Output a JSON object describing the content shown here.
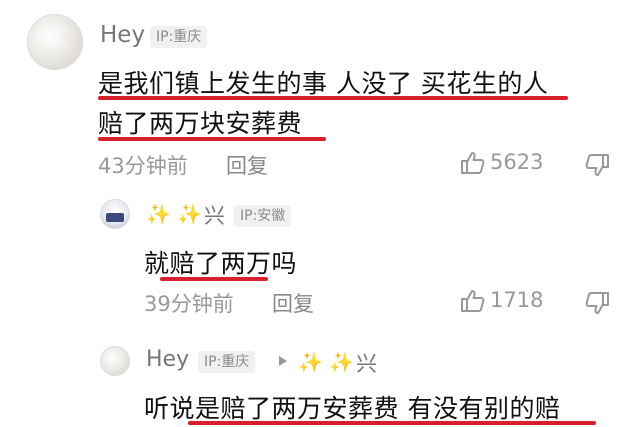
{
  "comments": [
    {
      "username": "Hey",
      "ip_tag": "IP:重庆",
      "content_line1": "是我们镇上发生的事  人没了  买花生的人",
      "content_line2": "赔了两万块安葬费",
      "time": "43分钟前",
      "reply_label": "回复",
      "likes": "5623",
      "replies": [
        {
          "username_sparkles": "✨ ✨",
          "username_text": "兴",
          "ip_tag": "IP:安徽",
          "content": "就赔了两万吗",
          "time": "39分钟前",
          "reply_label": "回复",
          "likes": "1718"
        },
        {
          "username": "Hey",
          "ip_tag": "IP:重庆",
          "reply_to_sparkles": "✨ ✨",
          "reply_to_text": "兴",
          "content": "听说是赔了两万安葬费  有没有别的赔"
        }
      ]
    }
  ],
  "colors": {
    "underline": "#d6202b",
    "meta_text": "#999999",
    "username": "#777777"
  },
  "icons": {
    "like": "thumb-up-icon",
    "dislike": "thumb-down-icon",
    "reply_arrow": "triangle-right-icon"
  }
}
